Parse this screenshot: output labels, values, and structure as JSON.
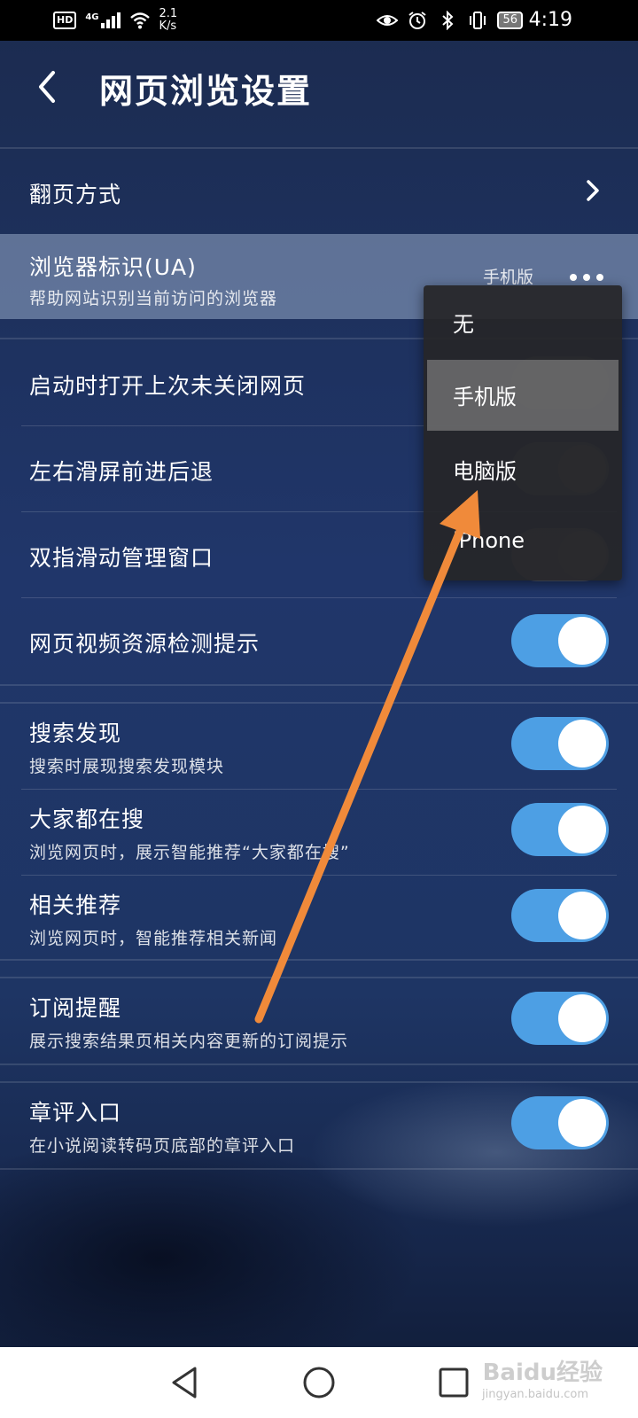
{
  "status_bar": {
    "hd": "HD",
    "network": "4G",
    "speed_value": "2.1",
    "speed_unit": "K/s",
    "battery": "56",
    "time": "4:19"
  },
  "header": {
    "title": "网页浏览设置"
  },
  "settings": {
    "page_turn": {
      "title": "翻页方式"
    },
    "ua": {
      "title": "浏览器标识(UA)",
      "subtitle": "帮助网站识别当前访问的浏览器",
      "value": "手机版"
    },
    "restore_pages": {
      "title": "启动时打开上次未关闭网页",
      "enabled": false
    },
    "swipe_nav": {
      "title": "左右滑屏前进后退",
      "enabled": false
    },
    "two_finger": {
      "title": "双指滑动管理窗口",
      "enabled": false
    },
    "video_detect": {
      "title": "网页视频资源检测提示",
      "enabled": true
    },
    "search_discover": {
      "title": "搜索发现",
      "subtitle": "搜索时展现搜索发现模块",
      "enabled": true
    },
    "everyone_search": {
      "title": "大家都在搜",
      "subtitle": "浏览网页时，展示智能推荐“大家都在搜”",
      "enabled": true
    },
    "related": {
      "title": "相关推荐",
      "subtitle": "浏览网页时，智能推荐相关新闻",
      "enabled": true
    },
    "subscription": {
      "title": "订阅提醒",
      "subtitle": "展示搜索结果页相关内容更新的订阅提示",
      "enabled": true
    },
    "chapter_review": {
      "title": "章评入口",
      "subtitle": "在小说阅读转码页底部的章评入口",
      "enabled": true
    }
  },
  "ua_menu": {
    "items": [
      "无",
      "手机版",
      "电脑版",
      "iPhone"
    ],
    "selected": "手机版"
  },
  "watermark": {
    "brand": "Baidu经验",
    "url": "jingyan.baidu.com"
  },
  "colors": {
    "toggle_on": "#4d9fe4",
    "annotation_arrow": "#f08a3a",
    "background": "#1d2f55"
  }
}
